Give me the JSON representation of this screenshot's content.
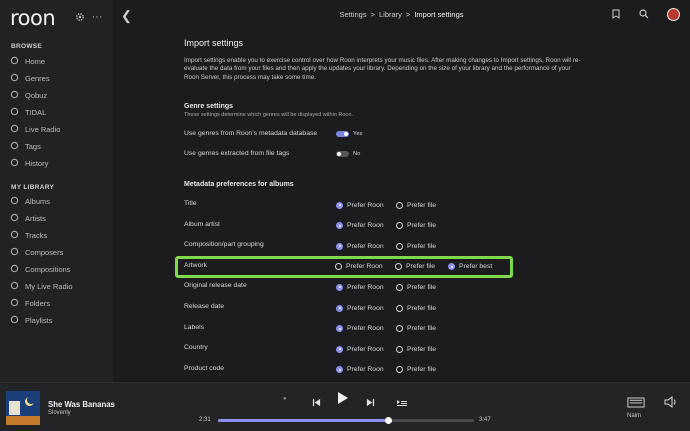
{
  "app": {
    "logo": "roon"
  },
  "sidebar": {
    "browse_heading": "BROWSE",
    "browse_items": [
      {
        "label": "Home",
        "icon": "home-icon"
      },
      {
        "label": "Genres",
        "icon": "genres-icon"
      },
      {
        "label": "Qobuz",
        "icon": "qobuz-icon"
      },
      {
        "label": "TIDAL",
        "icon": "tidal-icon"
      },
      {
        "label": "Live Radio",
        "icon": "radio-icon"
      },
      {
        "label": "Tags",
        "icon": "tag-icon"
      },
      {
        "label": "History",
        "icon": "history-icon"
      }
    ],
    "library_heading": "MY LIBRARY",
    "library_items": [
      {
        "label": "Albums",
        "icon": "album-icon"
      },
      {
        "label": "Artists",
        "icon": "artist-icon"
      },
      {
        "label": "Tracks",
        "icon": "track-icon"
      },
      {
        "label": "Composers",
        "icon": "composer-icon"
      },
      {
        "label": "Compositions",
        "icon": "composition-icon"
      },
      {
        "label": "My Live Radio",
        "icon": "radio-icon"
      },
      {
        "label": "Folders",
        "icon": "folder-icon"
      },
      {
        "label": "Playlists",
        "icon": "playlist-icon"
      }
    ]
  },
  "breadcrumb": {
    "items": [
      "Settings",
      "Library",
      "Import settings"
    ],
    "separator": ">"
  },
  "page": {
    "title": "Import settings",
    "intro": "Import settings enable you to exercise control over how Roon interprets your music files. After making changes to Import settings, Roon will re-evaluate the data from your files and then apply the updates your library. Depending on the size of your library and the performance of your Roon Server, this process may take some time."
  },
  "genre_settings": {
    "heading": "Genre settings",
    "subtitle": "These settings determine which genres will be displayed within Roon.",
    "rows": [
      {
        "label": "Use genres from Roon's metadata database",
        "state": "Yes",
        "on": true
      },
      {
        "label": "Use genres extracted from file tags",
        "state": "No",
        "on": false
      }
    ]
  },
  "metadata": {
    "heading": "Metadata preferences for albums",
    "option_labels": {
      "roon": "Prefer Roon",
      "file": "Prefer file",
      "best": "Prefer best"
    },
    "rows": [
      {
        "label": "Title",
        "selected": "roon"
      },
      {
        "label": "Album artist",
        "selected": "roon"
      },
      {
        "label": "Composition/part grouping",
        "selected": "roon"
      },
      {
        "label": "Artwork",
        "selected": "best",
        "has_best": true
      },
      {
        "label": "Original release date",
        "selected": "roon"
      },
      {
        "label": "Release date",
        "selected": "roon"
      },
      {
        "label": "Labels",
        "selected": "roon"
      },
      {
        "label": "Country",
        "selected": "roon"
      },
      {
        "label": "Product code",
        "selected": "roon"
      }
    ]
  },
  "player": {
    "title": "She Was Bananas",
    "artist": "Slovenly",
    "elapsed": "2:31",
    "total": "3:47",
    "progress": 0.665,
    "zone": "Naim"
  },
  "colors": {
    "accent": "#8a91f0",
    "highlight": "#7fd94a",
    "background": "#1c1c1e"
  }
}
